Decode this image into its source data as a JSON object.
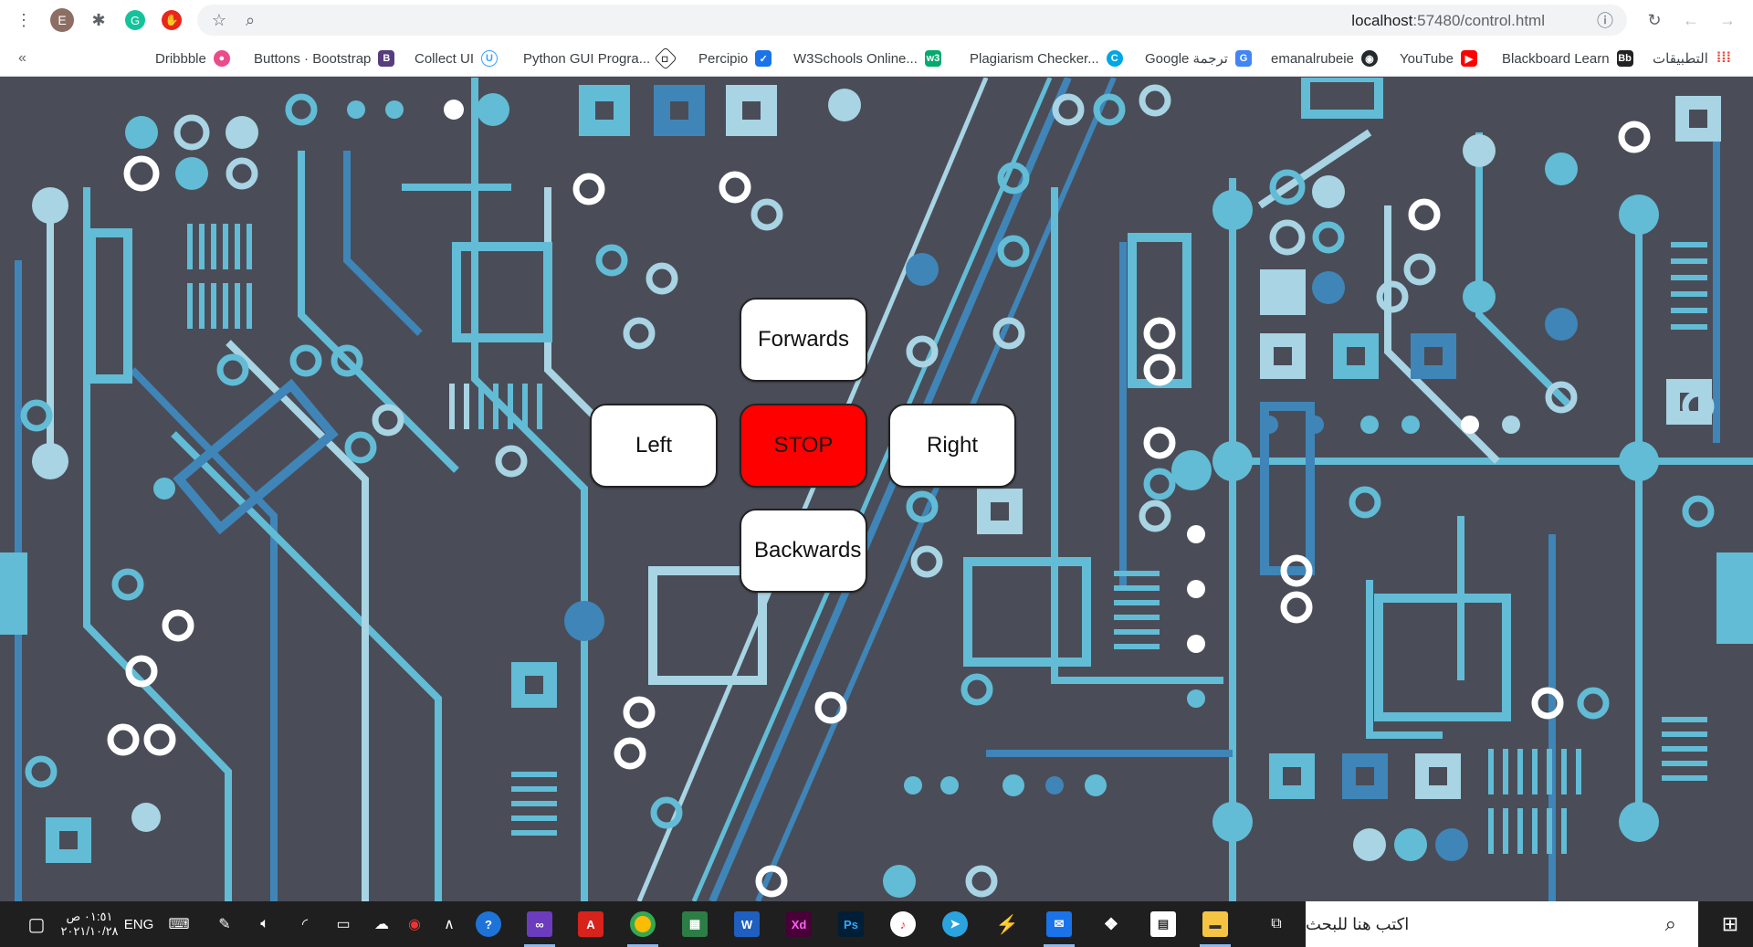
{
  "browser": {
    "url_host": "localhost",
    "url_rest": ":57480/control.html",
    "profile_initial": "E"
  },
  "bookmarks": [
    {
      "label": "Dribbble",
      "icon": "dribbble-icon",
      "color": "#ea4c89"
    },
    {
      "label": "Buttons · Bootstrap",
      "icon": "bootstrap-icon",
      "color": "#563d7c"
    },
    {
      "label": "Collect UI",
      "icon": "collectui-icon",
      "color": "#3aa0ff"
    },
    {
      "label": "Python GUI Progra...",
      "icon": "python-gui-icon",
      "color": "#333333"
    },
    {
      "label": "Percipio",
      "icon": "percipio-icon",
      "color": "#1a73e8"
    },
    {
      "label": "W3Schools Online...",
      "icon": "w3schools-icon",
      "color": "#04aa6d"
    },
    {
      "label": "Plagiarism Checker...",
      "icon": "plagiarism-icon",
      "color": "#00a8e1"
    },
    {
      "label": "Google ترجمة",
      "icon": "translate-icon",
      "color": "#4285f4"
    },
    {
      "label": "emanalrubeie",
      "icon": "github-icon",
      "color": "#24292e"
    },
    {
      "label": "YouTube",
      "icon": "youtube-icon",
      "color": "#ff0000"
    },
    {
      "label": "Blackboard Learn",
      "icon": "blackboard-icon",
      "color": "#222222"
    },
    {
      "label": "التطبيقات",
      "icon": "apps-grid-icon",
      "color": "#e94235"
    }
  ],
  "controls": {
    "forwards": "Forwards",
    "left": "Left",
    "stop": "STOP",
    "right": "Right",
    "backwards": "Backwards",
    "stop_color": "#ff0000"
  },
  "taskbar": {
    "search_placeholder": "اكتب هنا للبحث",
    "lang": "ENG",
    "time": "٠١:٥١ ص",
    "date": "٢٠٢١/١٠/٢٨"
  },
  "colors": {
    "circuit_bg": "#4a4d57",
    "trace_light": "#62bcd6",
    "trace_mid": "#3f85b8",
    "trace_pale": "#a8d4e4"
  }
}
